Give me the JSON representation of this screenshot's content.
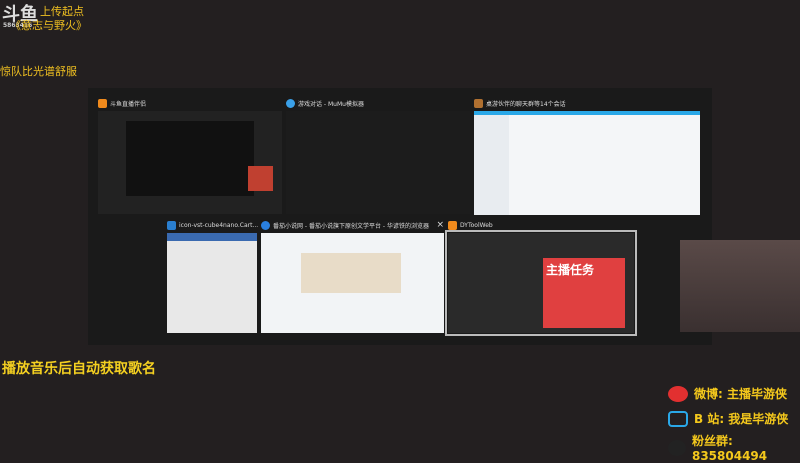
{
  "overlay": {
    "logo": "斗鱼",
    "room_id": "5863416",
    "line1": "上传起点",
    "line2": "《意志与野火》",
    "line3": "惊队比光谱舒服",
    "bottom_caption": "播放音乐后自动获取歌名"
  },
  "windows": [
    {
      "title": "斗鱼直播伴侣",
      "color": "#f08a1c"
    },
    {
      "title": "游戏对话 - MuMu模拟器",
      "color": "#3aa0e8"
    },
    {
      "title": "桌游伙伴的聊天群等14个会话",
      "color": "#b07030"
    },
    {
      "title": "icon-vst-cube4nano.Cart...",
      "color": "#2a7fd0"
    },
    {
      "title": "番茄小说网 - 番茄小说旗下原创文学平台 - 华谚铁的浏览器",
      "color": "#2a80e0"
    },
    {
      "title": "DYToolWeb",
      "color": "#f08a1c"
    }
  ],
  "close_label": "×",
  "promo": {
    "title": "主播任务"
  },
  "social": {
    "weibo": "微博: 主播毕游侠",
    "bilibili": "B 站: 我是毕游侠",
    "qq": "粉丝群: 835804494"
  }
}
